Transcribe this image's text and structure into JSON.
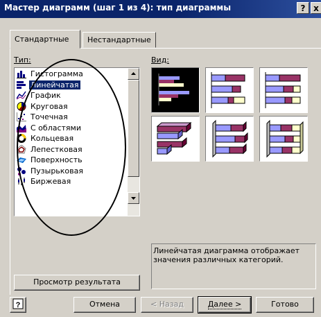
{
  "window": {
    "title": "Мастер диаграмм (шаг 1 из 4): тип диаграммы",
    "help_button": "?",
    "close_button": "x"
  },
  "tabs": [
    {
      "label": "Стандартные",
      "active": true
    },
    {
      "label": "Нестандартные",
      "active": false
    }
  ],
  "type_label": "Тип:",
  "view_label": "Вид:",
  "chart_types": [
    {
      "label": "Гистограмма",
      "icon": "column-chart-icon"
    },
    {
      "label": "Линейчатая",
      "icon": "bar-chart-icon",
      "selected": true
    },
    {
      "label": "График",
      "icon": "line-chart-icon"
    },
    {
      "label": "Круговая",
      "icon": "pie-chart-icon"
    },
    {
      "label": "Точечная",
      "icon": "scatter-chart-icon"
    },
    {
      "label": "С областями",
      "icon": "area-chart-icon"
    },
    {
      "label": "Кольцевая",
      "icon": "doughnut-chart-icon"
    },
    {
      "label": "Лепестковая",
      "icon": "radar-chart-icon"
    },
    {
      "label": "Поверхность",
      "icon": "surface-chart-icon"
    },
    {
      "label": "Пузырьковая",
      "icon": "bubble-chart-icon"
    },
    {
      "label": "Биржевая",
      "icon": "stock-chart-icon"
    }
  ],
  "description": "Линейчатая диаграмма отображает значения различных категорий.",
  "buttons": {
    "preview": "Просмотр результата",
    "help": "?",
    "cancel": "Отмена",
    "back": "< Назад",
    "next": "Далее >",
    "finish": "Готово"
  },
  "colors": {
    "titlebar": "#0a246a",
    "selection": "#0a246a",
    "dialog": "#d4d0c8",
    "series1": "#9999ff",
    "series2": "#993366",
    "series3": "#ffffcc",
    "annotation": "#000000"
  }
}
